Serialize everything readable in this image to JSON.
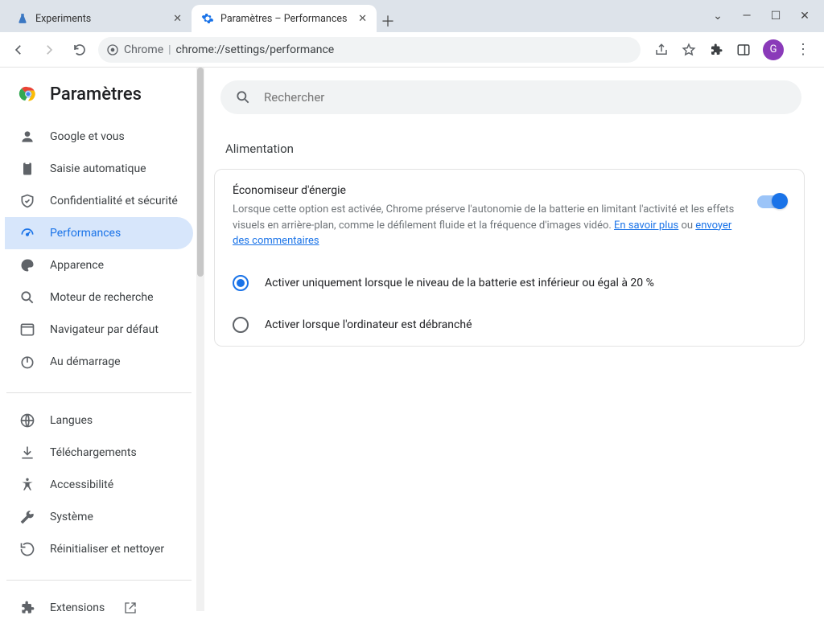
{
  "window": {
    "tabs": [
      {
        "title": "Experiments",
        "favicon_color": "#3b78c3",
        "active": false
      },
      {
        "title": "Paramètres – Performances",
        "favicon_color": "#1a73e8",
        "active": true
      }
    ]
  },
  "toolbar": {
    "url_origin": "Chrome",
    "url_path": "chrome://settings/performance",
    "avatar_letter": "G"
  },
  "header": {
    "title": "Paramètres"
  },
  "search": {
    "placeholder": "Rechercher"
  },
  "sidebar": {
    "items": [
      {
        "label": "Google et vous",
        "icon": "person"
      },
      {
        "label": "Saisie automatique",
        "icon": "autofill"
      },
      {
        "label": "Confidentialité et sécurité",
        "icon": "shield"
      },
      {
        "label": "Performances",
        "icon": "speed",
        "active": true
      },
      {
        "label": "Apparence",
        "icon": "palette"
      },
      {
        "label": "Moteur de recherche",
        "icon": "search"
      },
      {
        "label": "Navigateur par défaut",
        "icon": "browser"
      },
      {
        "label": "Au démarrage",
        "icon": "power"
      }
    ],
    "items2": [
      {
        "label": "Langues",
        "icon": "globe"
      },
      {
        "label": "Téléchargements",
        "icon": "download"
      },
      {
        "label": "Accessibilité",
        "icon": "a11y"
      },
      {
        "label": "Système",
        "icon": "wrench"
      },
      {
        "label": "Réinitialiser et nettoyer",
        "icon": "restore"
      }
    ],
    "extensions_label": "Extensions"
  },
  "main": {
    "section_title": "Alimentation",
    "energy": {
      "title": "Économiseur d'énergie",
      "desc_prefix": "Lorsque cette option est activée, Chrome préserve l'autonomie de la batterie en limitant l'activité et les effets visuels en arrière-plan, comme le défilement fluide et la fréquence d'images vidéo. ",
      "link1": "En savoir plus",
      "or": " ou ",
      "link2": "envoyer des commentaires",
      "toggle_on": true,
      "options": [
        {
          "label": "Activer uniquement lorsque le niveau de la batterie est inférieur ou égal à 20 %",
          "selected": true
        },
        {
          "label": "Activer lorsque l'ordinateur est débranché",
          "selected": false
        }
      ]
    }
  }
}
